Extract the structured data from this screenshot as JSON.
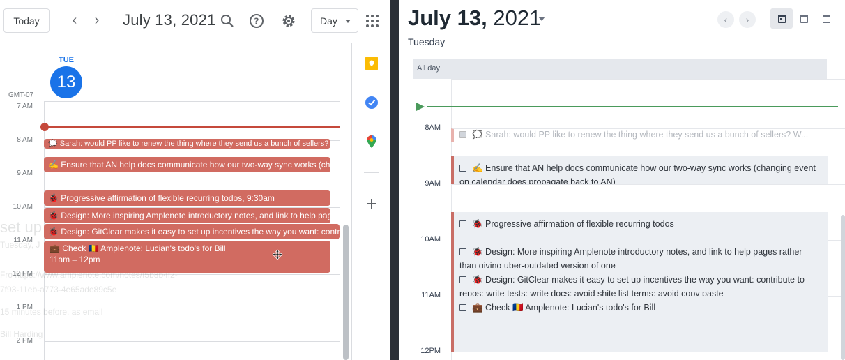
{
  "left_calendar": {
    "today_label": "Today",
    "prev_icon": "chevron-left-icon",
    "next_icon": "chevron-right-icon",
    "title": "July 13, 2021",
    "view_select": "Day",
    "day_name": "TUE",
    "day_number": "13",
    "timezone": "GMT-07",
    "hours": [
      "7 AM",
      "8 AM",
      "9 AM",
      "10 AM",
      "11 AM",
      "12 PM",
      "1 PM",
      "2 PM"
    ],
    "ghost_popup": {
      "title": "set up",
      "date": "Tuesday, J",
      "line1": "Fro   https://www.amplenote.com/notes/f5b8b4f2-",
      "line2": "7f93-11eb-a773-4e65ade89c5e",
      "line3": "15 minutes before, as email",
      "line4": "Bill Harding"
    },
    "events": [
      {
        "emoji": "🗯️",
        "text": "Sarah: would PP like to renew the thing where they send us a bunch of sellers? We used"
      },
      {
        "emoji": "✍️",
        "text": "Ensure that AN help docs communicate how our two-way sync works (changing event"
      },
      {
        "emoji": "🐞",
        "text": "Progressive affirmation of flexible recurring todos, 9:30am"
      },
      {
        "emoji": "🐞",
        "text": "Design: More inspiring Amplenote introductory notes, and link to help pages rather"
      },
      {
        "emoji": "🐞",
        "text": "Design: GitClear makes it easy to set up incentives the way you want: contribute to"
      },
      {
        "emoji": "💼",
        "text": "Check 🇷🇴 Amplenote: Lucian's todo's for Bill",
        "time": "11am – 12pm"
      }
    ],
    "colors": {
      "accent": "#1a73e8",
      "event": "#d16b61",
      "now": "#c5493b"
    }
  },
  "right_calendar": {
    "title_bold": "July 13,",
    "title_rest": " 2021",
    "weekday": "Tuesday",
    "allday_label": "All day",
    "hours": [
      "8AM",
      "9AM",
      "10AM",
      "11AM",
      "12PM"
    ],
    "tasks": [
      {
        "text": "🗯️ Sarah: would PP like to renew the thing where they send us a bunch of sellers? W..."
      },
      {
        "text": "✍️ Ensure that AN help docs communicate how our two-way sync works (changing event on calendar does propagate back to AN)"
      },
      {
        "text": "🐞 Progressive affirmation of flexible recurring todos"
      },
      {
        "text": "🐞 Design: More inspiring Amplenote introductory notes, and link to help pages rather than giving uber-outdated version of one"
      },
      {
        "text": "🐞 Design: GitClear makes it easy to set up incentives the way you want: contribute to repos; write tests; write docs; avoid shite list terms; avoid copy paste"
      },
      {
        "text": "💼 Check 🇷🇴 Amplenote: Lucian's todo's for Bill"
      }
    ],
    "colors": {
      "task_bar": "#c96e66",
      "now": "#4a9a5b"
    }
  }
}
